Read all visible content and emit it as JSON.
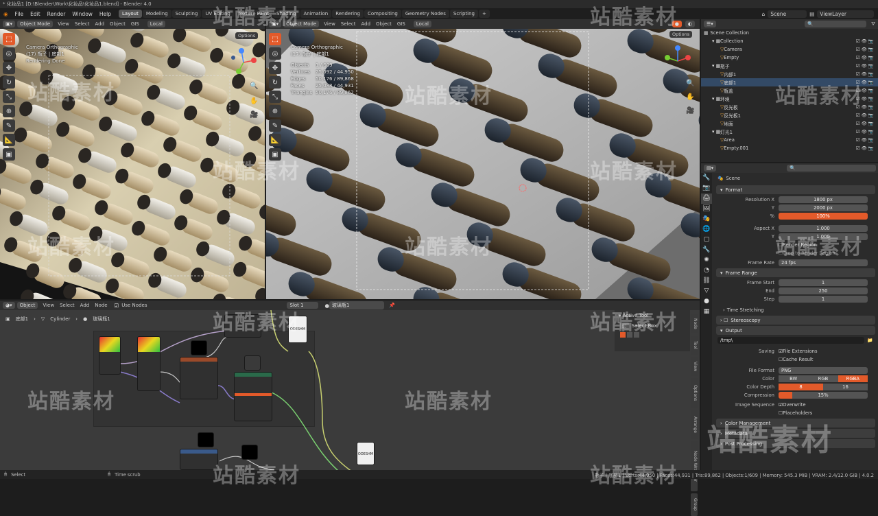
{
  "window_title": "* 化妆品1 [D:\\Blender\\Work\\化妆品\\化妆品1.blend] - Blender 4.0",
  "menu": [
    "File",
    "Edit",
    "Render",
    "Window",
    "Help"
  ],
  "workspaces": [
    "Layout",
    "Modeling",
    "Sculpting",
    "UV Editing",
    "Texture Paint",
    "Shading",
    "Animation",
    "Rendering",
    "Compositing",
    "Geometry Nodes",
    "Scripting"
  ],
  "active_workspace": "Layout",
  "scene_name": "Scene",
  "view_layer": "ViewLayer",
  "viewport_left": {
    "mode": "Object Mode",
    "menus": [
      "View",
      "Select",
      "Add",
      "Object",
      "GIS"
    ],
    "orientation": "Local",
    "options": "Options",
    "overlay": [
      "Camera Orthographic",
      "(17) 瓶子 | 底部1",
      "Rendering Done"
    ]
  },
  "viewport_right": {
    "mode": "Object Mode",
    "menus": [
      "View",
      "Select",
      "Add",
      "Object",
      "GIS"
    ],
    "orientation": "Local",
    "options": "Options",
    "overlay": [
      "Camera Orthographic",
      "(17) 瓶子 | 底部1"
    ],
    "stats": [
      {
        "k": "Objects",
        "v": "1 / 609"
      },
      {
        "k": "Vertices",
        "v": "25,092 / 44,950"
      },
      {
        "k": "Edges",
        "v": "50,176 / 89,868"
      },
      {
        "k": "Faces",
        "v": "25,088 / 44,931"
      },
      {
        "k": "Triangles",
        "v": "50,176 / 89,862"
      }
    ]
  },
  "outliner": {
    "header": "Scene Collection",
    "rows": [
      {
        "label": "Collection",
        "indent": 1,
        "sel": false
      },
      {
        "label": "Camera",
        "indent": 2,
        "sel": false
      },
      {
        "label": "Empty",
        "indent": 2,
        "sel": false
      },
      {
        "label": "瓶子",
        "indent": 1,
        "sel": false
      },
      {
        "label": "内部1",
        "indent": 2,
        "sel": false
      },
      {
        "label": "底部1",
        "indent": 2,
        "sel": true
      },
      {
        "label": "瓶盖",
        "indent": 2,
        "sel": false
      },
      {
        "label": "环境",
        "indent": 1,
        "sel": false
      },
      {
        "label": "反光板",
        "indent": 2,
        "sel": false
      },
      {
        "label": "反光板1",
        "indent": 2,
        "sel": false
      },
      {
        "label": "地面",
        "indent": 2,
        "sel": false
      },
      {
        "label": "灯光1",
        "indent": 1,
        "sel": false
      },
      {
        "label": "Area",
        "indent": 2,
        "sel": false
      },
      {
        "label": "Empty.001",
        "indent": 2,
        "sel": false
      }
    ]
  },
  "properties": {
    "context": "Scene",
    "format": {
      "title": "Format",
      "res_x_label": "Resolution X",
      "res_x": "1800 px",
      "res_y_label": "Y",
      "res_y": "2000 px",
      "pct_label": "%",
      "pct": "100%",
      "aspect_x_label": "Aspect X",
      "aspect_x": "1.000",
      "aspect_y_label": "Y",
      "aspect_y": "1.000",
      "render_region": "Render Region",
      "crop": "Crop to Render Region",
      "frame_rate_label": "Frame Rate",
      "frame_rate": "24 fps"
    },
    "frame_range": {
      "title": "Frame Range",
      "start_label": "Frame Start",
      "start": "1",
      "end_label": "End",
      "end": "250",
      "step_label": "Step",
      "step": "1",
      "time_stretching": "Time Stretching"
    },
    "stereoscopy": "Stereoscopy",
    "output": {
      "title": "Output",
      "path": "/tmp\\",
      "saving_label": "Saving",
      "file_ext": "File Extensions",
      "cache_result": "Cache Result",
      "file_format_label": "File Format",
      "file_format": "PNG",
      "color_label": "Color",
      "color_opts": [
        "BW",
        "RGB",
        "RGBA"
      ],
      "color_active": "RGBA",
      "depth_label": "Color Depth",
      "depth_opts": [
        "8",
        "16"
      ],
      "depth_active": "8",
      "compression_label": "Compression",
      "compression": "15%",
      "compression_frac": 0.15,
      "image_seq_label": "Image Sequence",
      "overwrite": "Overwrite",
      "placeholders": "Placeholders"
    },
    "color_management": "Color Management",
    "metadata": "Metadata",
    "post_processing": "Post Processing"
  },
  "node_editor": {
    "type": "Object",
    "menus": [
      "View",
      "Select",
      "Add",
      "Node"
    ],
    "use_nodes": "Use Nodes",
    "slot": "Slot 1",
    "material": "玻璃瓶1",
    "breadcrumb": [
      "底部1",
      "Cylinder",
      "玻璃瓶1"
    ],
    "sidebar_title": "Active Tool",
    "sidebar_tool": "Select Box",
    "tabs": [
      "Node",
      "Tool",
      "View",
      "Options",
      "Arrange",
      "Node Wrangler",
      "Group"
    ]
  },
  "status": {
    "select": "Select",
    "time_scrub": "Time scrub",
    "right": "瓶子 | 底部1 | Verts:44,950 | Faces:44,931 | Tris:89,862 | Objects:1/609 | Memory: 545.3 MiB | VRAM: 2.4/12.0 GiB | 4.0.2"
  },
  "watermark": "站酷素材",
  "colors": {
    "accent": "#e35a2a",
    "selection": "#334a66"
  }
}
